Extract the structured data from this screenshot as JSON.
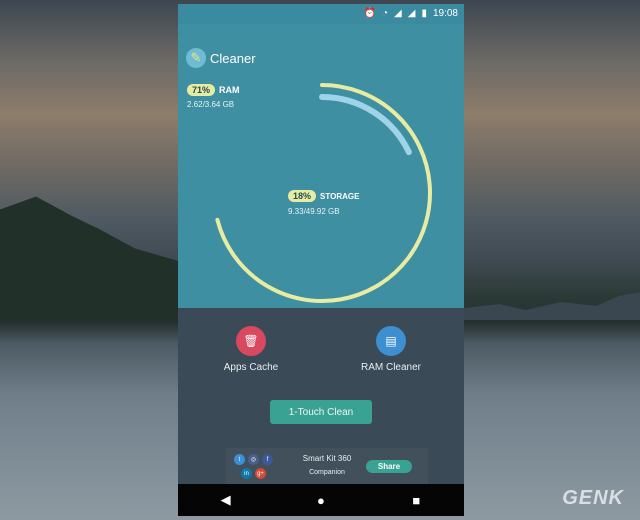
{
  "status_bar": {
    "time": "19:08",
    "icons": [
      "alarm-icon",
      "wifi-icon",
      "signal-icon",
      "signal-icon",
      "battery-icon"
    ]
  },
  "app": {
    "title": "Cleaner",
    "logo_icon": "broom-icon"
  },
  "ram": {
    "percent_label": "71%",
    "percent": 71,
    "label": "RAM",
    "usage": "2.62/3.64 GB"
  },
  "storage": {
    "percent_label": "18%",
    "percent": 18,
    "label": "STORAGE",
    "usage": "9.33/49.92 GB"
  },
  "actions": [
    {
      "label": "Apps Cache",
      "icon": "cache-icon",
      "color": "#d8485f"
    },
    {
      "label": "RAM Cleaner",
      "icon": "memory-icon",
      "color": "#3d8fd0"
    }
  ],
  "clean_button": {
    "label": "1-Touch Clean"
  },
  "promo": {
    "title": "Smart Kit 360",
    "subtitle": "Companion",
    "share_label": "Share",
    "social_icons": [
      "twitter-icon",
      "instagram-icon",
      "facebook-icon",
      "linkedin-icon",
      "google-plus-icon"
    ]
  },
  "nav": [
    "back-icon",
    "home-icon",
    "recents-icon"
  ],
  "watermark": {
    "text": "GENK"
  },
  "colors": {
    "header_bg": "#3f8fa3",
    "ram_ring": "#e7eca2",
    "storage_ring": "#9fd3e8",
    "accent_button": "#3aa292"
  }
}
